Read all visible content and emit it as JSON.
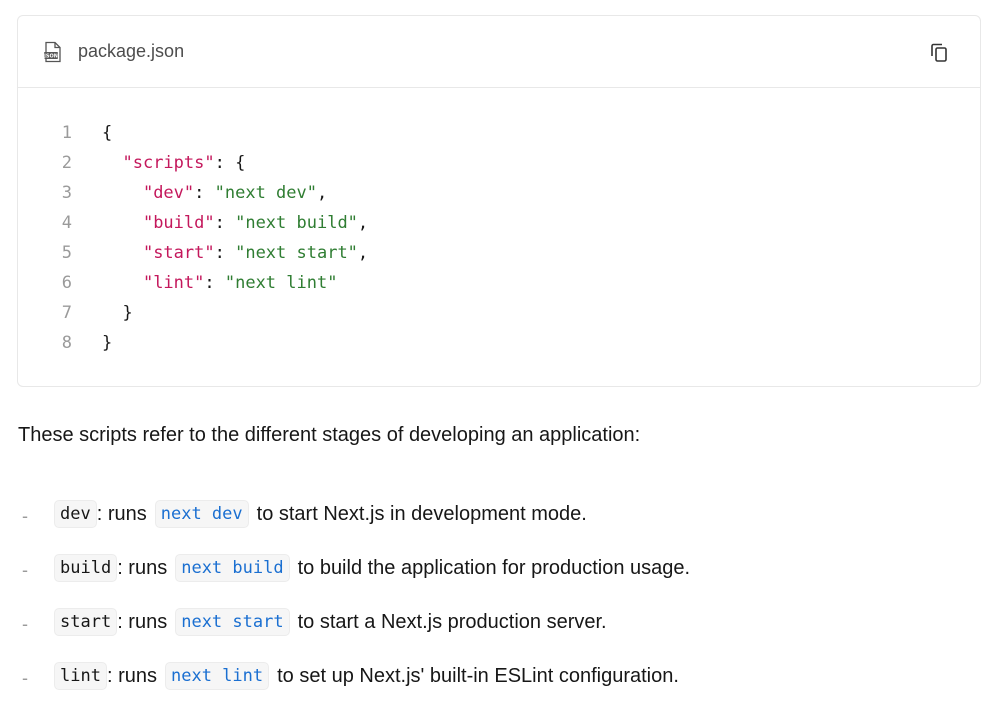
{
  "code_block": {
    "file_name": "package.json",
    "file_icon": "json-file-icon",
    "copy_icon": "copy-icon",
    "lines": [
      {
        "num": "1",
        "indent": "",
        "key": "",
        "sep": "",
        "val": "",
        "open": "{",
        "close": ""
      },
      {
        "num": "2",
        "indent": "  ",
        "key": "\"scripts\"",
        "sep": ": ",
        "val": "",
        "open": "{",
        "close": ""
      },
      {
        "num": "3",
        "indent": "    ",
        "key": "\"dev\"",
        "sep": ": ",
        "val": "\"next dev\"",
        "open": "",
        "close": ","
      },
      {
        "num": "4",
        "indent": "    ",
        "key": "\"build\"",
        "sep": ": ",
        "val": "\"next build\"",
        "open": "",
        "close": ","
      },
      {
        "num": "5",
        "indent": "    ",
        "key": "\"start\"",
        "sep": ": ",
        "val": "\"next start\"",
        "open": "",
        "close": ","
      },
      {
        "num": "6",
        "indent": "    ",
        "key": "\"lint\"",
        "sep": ": ",
        "val": "\"next lint\"",
        "open": "",
        "close": ""
      },
      {
        "num": "7",
        "indent": "  ",
        "key": "",
        "sep": "",
        "val": "",
        "open": "}",
        "close": ""
      },
      {
        "num": "8",
        "indent": "",
        "key": "",
        "sep": "",
        "val": "",
        "open": "}",
        "close": ""
      }
    ]
  },
  "intro_text": "These scripts refer to the different stages of developing an application:",
  "scripts": [
    {
      "name": "dev",
      "runs": ": runs",
      "command": "next dev",
      "desc": "to start Next.js in development mode."
    },
    {
      "name": "build",
      "runs": ": runs",
      "command": "next build",
      "desc": "to build the application for production usage."
    },
    {
      "name": "start",
      "runs": ": runs",
      "command": "next start",
      "desc": "to start a Next.js production server."
    },
    {
      "name": "lint",
      "runs": ": runs",
      "command": "next lint",
      "desc": "to set up Next.js' built-in ESLint configuration."
    }
  ],
  "colors": {
    "key": "#c4185c",
    "string": "#2f7d32",
    "link": "#1a6fd1"
  }
}
